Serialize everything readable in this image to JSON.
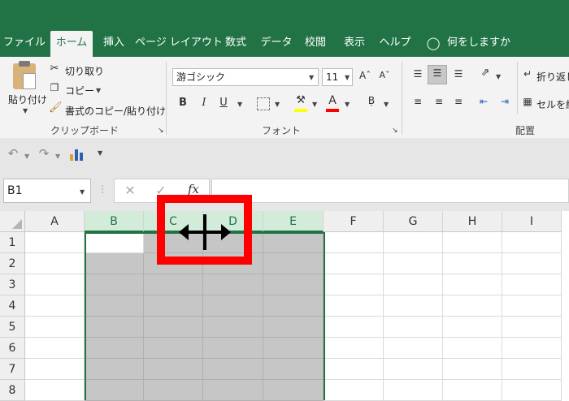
{
  "tabs": [
    "ファイル",
    "ホーム",
    "挿入",
    "ページ レイアウト",
    "数式",
    "データ",
    "校閲",
    "表示",
    "ヘルプ"
  ],
  "tell_me": "何をしますか",
  "clipboard": {
    "paste": "貼り付け",
    "cut": "切り取り",
    "copy": "コピー",
    "format_painter": "書式のコピー/貼り付け",
    "label": "クリップボード"
  },
  "font": {
    "name": "游ゴシック",
    "size": "11",
    "bold": "B",
    "italic": "I",
    "underline": "U",
    "color_a": "A",
    "label": "フォント"
  },
  "alignment": {
    "wrap": "折り返し",
    "merge": "セルを結",
    "label": "配置"
  },
  "name_box": "B1",
  "fx": "fx",
  "columns": [
    "A",
    "B",
    "C",
    "D",
    "E",
    "F",
    "G",
    "H",
    "I"
  ],
  "selected_columns": [
    "B",
    "C",
    "D",
    "E"
  ],
  "rows": [
    "1",
    "2",
    "3",
    "4",
    "5",
    "6",
    "7",
    "8"
  ],
  "colors": {
    "brand": "#217346",
    "highlight_red": "#ff0000",
    "selection": "#c6c6c6",
    "header_selected": "#d2ecd9"
  }
}
